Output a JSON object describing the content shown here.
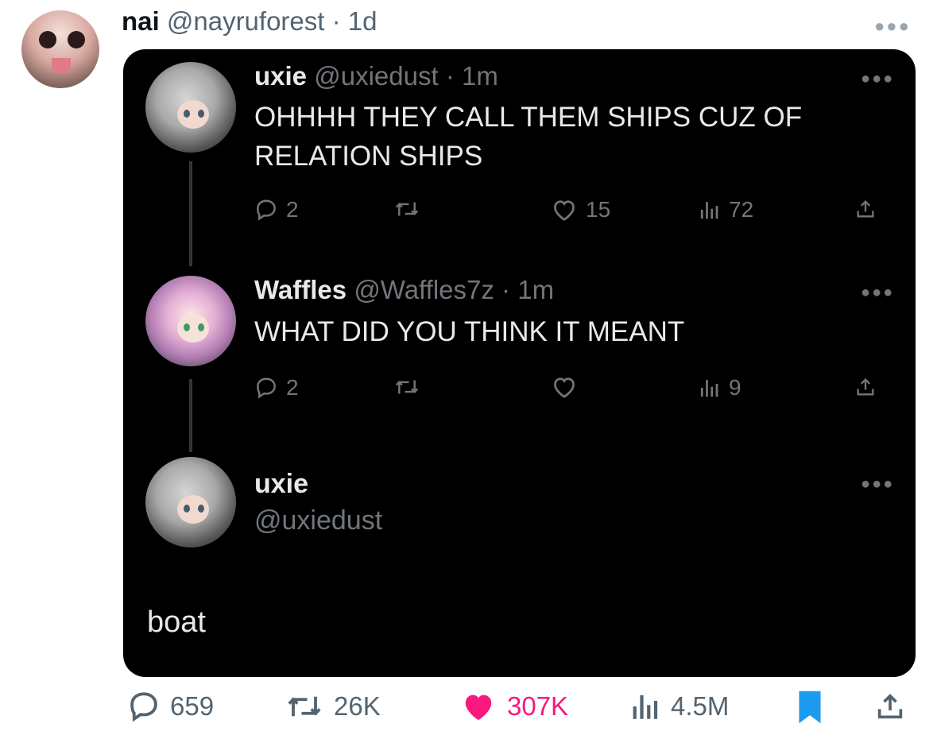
{
  "outer_tweet": {
    "author_name": "nai",
    "handle": "@nayruforest",
    "separator": "·",
    "time": "1d",
    "text": "boat",
    "actions": {
      "replies": "659",
      "retweets": "26K",
      "likes": "307K",
      "views": "4.5M"
    },
    "liked_color": "#f91880",
    "bookmark_color": "#1d9bf0"
  },
  "thread": [
    {
      "author_name": "uxie",
      "handle": "@uxiedust",
      "separator": "·",
      "time": "1m",
      "text": "OHHHH THEY CALL THEM SHIPS CUZ OF RELATION SHIPS",
      "replies": "2",
      "likes": "15",
      "views": "72"
    },
    {
      "author_name": "Waffles",
      "handle": "@Waffles7z",
      "separator": "·",
      "time": "1m",
      "text": "WHAT DID YOU THINK IT MEANT",
      "replies": "2",
      "likes": "",
      "views": "9"
    },
    {
      "author_name": "uxie",
      "handle": "@uxiedust"
    }
  ]
}
